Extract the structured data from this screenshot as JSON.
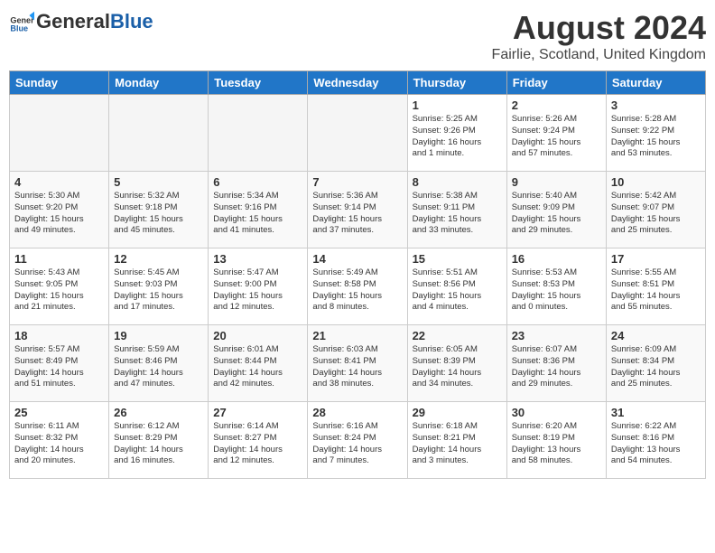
{
  "header": {
    "logo_general": "General",
    "logo_blue": "Blue",
    "month_year": "August 2024",
    "location": "Fairlie, Scotland, United Kingdom"
  },
  "days_of_week": [
    "Sunday",
    "Monday",
    "Tuesday",
    "Wednesday",
    "Thursday",
    "Friday",
    "Saturday"
  ],
  "weeks": [
    [
      {
        "num": "",
        "info": ""
      },
      {
        "num": "",
        "info": ""
      },
      {
        "num": "",
        "info": ""
      },
      {
        "num": "",
        "info": ""
      },
      {
        "num": "1",
        "info": "Sunrise: 5:25 AM\nSunset: 9:26 PM\nDaylight: 16 hours\nand 1 minute."
      },
      {
        "num": "2",
        "info": "Sunrise: 5:26 AM\nSunset: 9:24 PM\nDaylight: 15 hours\nand 57 minutes."
      },
      {
        "num": "3",
        "info": "Sunrise: 5:28 AM\nSunset: 9:22 PM\nDaylight: 15 hours\nand 53 minutes."
      }
    ],
    [
      {
        "num": "4",
        "info": "Sunrise: 5:30 AM\nSunset: 9:20 PM\nDaylight: 15 hours\nand 49 minutes."
      },
      {
        "num": "5",
        "info": "Sunrise: 5:32 AM\nSunset: 9:18 PM\nDaylight: 15 hours\nand 45 minutes."
      },
      {
        "num": "6",
        "info": "Sunrise: 5:34 AM\nSunset: 9:16 PM\nDaylight: 15 hours\nand 41 minutes."
      },
      {
        "num": "7",
        "info": "Sunrise: 5:36 AM\nSunset: 9:14 PM\nDaylight: 15 hours\nand 37 minutes."
      },
      {
        "num": "8",
        "info": "Sunrise: 5:38 AM\nSunset: 9:11 PM\nDaylight: 15 hours\nand 33 minutes."
      },
      {
        "num": "9",
        "info": "Sunrise: 5:40 AM\nSunset: 9:09 PM\nDaylight: 15 hours\nand 29 minutes."
      },
      {
        "num": "10",
        "info": "Sunrise: 5:42 AM\nSunset: 9:07 PM\nDaylight: 15 hours\nand 25 minutes."
      }
    ],
    [
      {
        "num": "11",
        "info": "Sunrise: 5:43 AM\nSunset: 9:05 PM\nDaylight: 15 hours\nand 21 minutes."
      },
      {
        "num": "12",
        "info": "Sunrise: 5:45 AM\nSunset: 9:03 PM\nDaylight: 15 hours\nand 17 minutes."
      },
      {
        "num": "13",
        "info": "Sunrise: 5:47 AM\nSunset: 9:00 PM\nDaylight: 15 hours\nand 12 minutes."
      },
      {
        "num": "14",
        "info": "Sunrise: 5:49 AM\nSunset: 8:58 PM\nDaylight: 15 hours\nand 8 minutes."
      },
      {
        "num": "15",
        "info": "Sunrise: 5:51 AM\nSunset: 8:56 PM\nDaylight: 15 hours\nand 4 minutes."
      },
      {
        "num": "16",
        "info": "Sunrise: 5:53 AM\nSunset: 8:53 PM\nDaylight: 15 hours\nand 0 minutes."
      },
      {
        "num": "17",
        "info": "Sunrise: 5:55 AM\nSunset: 8:51 PM\nDaylight: 14 hours\nand 55 minutes."
      }
    ],
    [
      {
        "num": "18",
        "info": "Sunrise: 5:57 AM\nSunset: 8:49 PM\nDaylight: 14 hours\nand 51 minutes."
      },
      {
        "num": "19",
        "info": "Sunrise: 5:59 AM\nSunset: 8:46 PM\nDaylight: 14 hours\nand 47 minutes."
      },
      {
        "num": "20",
        "info": "Sunrise: 6:01 AM\nSunset: 8:44 PM\nDaylight: 14 hours\nand 42 minutes."
      },
      {
        "num": "21",
        "info": "Sunrise: 6:03 AM\nSunset: 8:41 PM\nDaylight: 14 hours\nand 38 minutes."
      },
      {
        "num": "22",
        "info": "Sunrise: 6:05 AM\nSunset: 8:39 PM\nDaylight: 14 hours\nand 34 minutes."
      },
      {
        "num": "23",
        "info": "Sunrise: 6:07 AM\nSunset: 8:36 PM\nDaylight: 14 hours\nand 29 minutes."
      },
      {
        "num": "24",
        "info": "Sunrise: 6:09 AM\nSunset: 8:34 PM\nDaylight: 14 hours\nand 25 minutes."
      }
    ],
    [
      {
        "num": "25",
        "info": "Sunrise: 6:11 AM\nSunset: 8:32 PM\nDaylight: 14 hours\nand 20 minutes."
      },
      {
        "num": "26",
        "info": "Sunrise: 6:12 AM\nSunset: 8:29 PM\nDaylight: 14 hours\nand 16 minutes."
      },
      {
        "num": "27",
        "info": "Sunrise: 6:14 AM\nSunset: 8:27 PM\nDaylight: 14 hours\nand 12 minutes."
      },
      {
        "num": "28",
        "info": "Sunrise: 6:16 AM\nSunset: 8:24 PM\nDaylight: 14 hours\nand 7 minutes."
      },
      {
        "num": "29",
        "info": "Sunrise: 6:18 AM\nSunset: 8:21 PM\nDaylight: 14 hours\nand 3 minutes."
      },
      {
        "num": "30",
        "info": "Sunrise: 6:20 AM\nSunset: 8:19 PM\nDaylight: 13 hours\nand 58 minutes."
      },
      {
        "num": "31",
        "info": "Sunrise: 6:22 AM\nSunset: 8:16 PM\nDaylight: 13 hours\nand 54 minutes."
      }
    ]
  ]
}
